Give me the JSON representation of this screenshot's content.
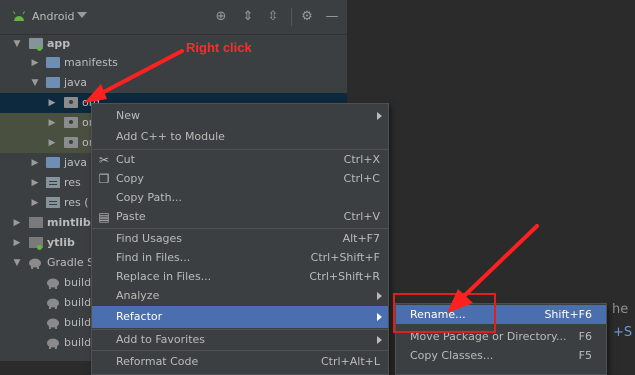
{
  "toolbar": {
    "title": "Android",
    "icons": [
      "android-icon",
      "dropdown-chevron-icon",
      "locate-target-icon",
      "expand-all-icon",
      "collapse-all-icon",
      "gear-icon",
      "minimize-icon"
    ]
  },
  "tree": {
    "app": "app",
    "manifests": "manifests",
    "java": "java",
    "org1": "org",
    "org2": "or",
    "org3": "or",
    "java_generated": "java (",
    "res1": "res",
    "res2": "res (",
    "mintlib": "mintlib",
    "ytlib": "ytlib",
    "gradle_scripts": "Gradle Sc",
    "build1": "build.",
    "build2": "build.",
    "build3": "build.",
    "build4": "build."
  },
  "menu": {
    "new": "New",
    "add_cpp": "Add C++ to Module",
    "cut": "Cut",
    "cut_sc": "Ctrl+X",
    "copy": "Copy",
    "copy_sc": "Ctrl+C",
    "copy_path": "Copy Path...",
    "paste": "Paste",
    "paste_sc": "Ctrl+V",
    "find_usages": "Find Usages",
    "find_usages_sc": "Alt+F7",
    "find_in_files": "Find in Files...",
    "find_in_files_sc": "Ctrl+Shift+F",
    "replace_in_files": "Replace in Files...",
    "replace_in_files_sc": "Ctrl+Shift+R",
    "analyze": "Analyze",
    "refactor": "Refactor",
    "add_to_favorites": "Add to Favorites",
    "reformat_code": "Reformat Code",
    "reformat_code_sc": "Ctrl+Alt+L"
  },
  "submenu": {
    "rename": "Rename...",
    "rename_sc": "Shift+F6",
    "move_package": "Move Package or Directory...",
    "move_package_sc": "F6",
    "copy_classes": "Copy Classes...",
    "copy_classes_sc": "F5"
  },
  "editor": {
    "text1": "he",
    "text2": "+S"
  },
  "annotation": {
    "right_click": "Right click",
    "color": "#ff2a2a"
  },
  "colors": {
    "selection": "#4b6eaf",
    "pane": "#3c3f41",
    "editor": "#2b2b2b"
  }
}
